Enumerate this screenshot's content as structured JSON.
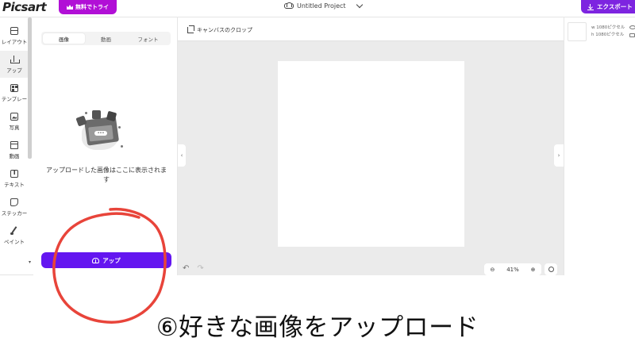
{
  "topbar": {
    "logo": "Picsart",
    "trial_label": "無料でトライ",
    "project_title": "Untitled Project",
    "export_label": "エクスポート"
  },
  "rail": {
    "items": [
      {
        "label": "レイアウト",
        "icon": "layout-icon"
      },
      {
        "label": "アップ",
        "icon": "upload-icon"
      },
      {
        "label": "テンプレー",
        "icon": "template-icon"
      },
      {
        "label": "写真",
        "icon": "photo-icon"
      },
      {
        "label": "動画",
        "icon": "video-icon"
      },
      {
        "label": "テキスト",
        "icon": "text-icon"
      },
      {
        "label": "ステッカー",
        "icon": "sticker-icon"
      },
      {
        "label": "ペイント",
        "icon": "paint-icon"
      }
    ]
  },
  "panel": {
    "tabs": [
      "画像",
      "動画",
      "フォント"
    ],
    "empty_text": "アップロードした画像はここに表示されます",
    "upload_label": "アップ"
  },
  "workspace": {
    "crop_label": "キャンバスのクロップ",
    "zoom_value": "41%"
  },
  "rpanel": {
    "width_label": "w 1080ピクセル",
    "height_label": "h 1080ピクセル"
  },
  "caption": "⑥好きな画像をアップロード",
  "colors": {
    "brand_purple": "#7d24e0",
    "trial_magenta": "#b10fd6",
    "upload_purple": "#6416f0",
    "annotation_red": "#e8443a"
  }
}
